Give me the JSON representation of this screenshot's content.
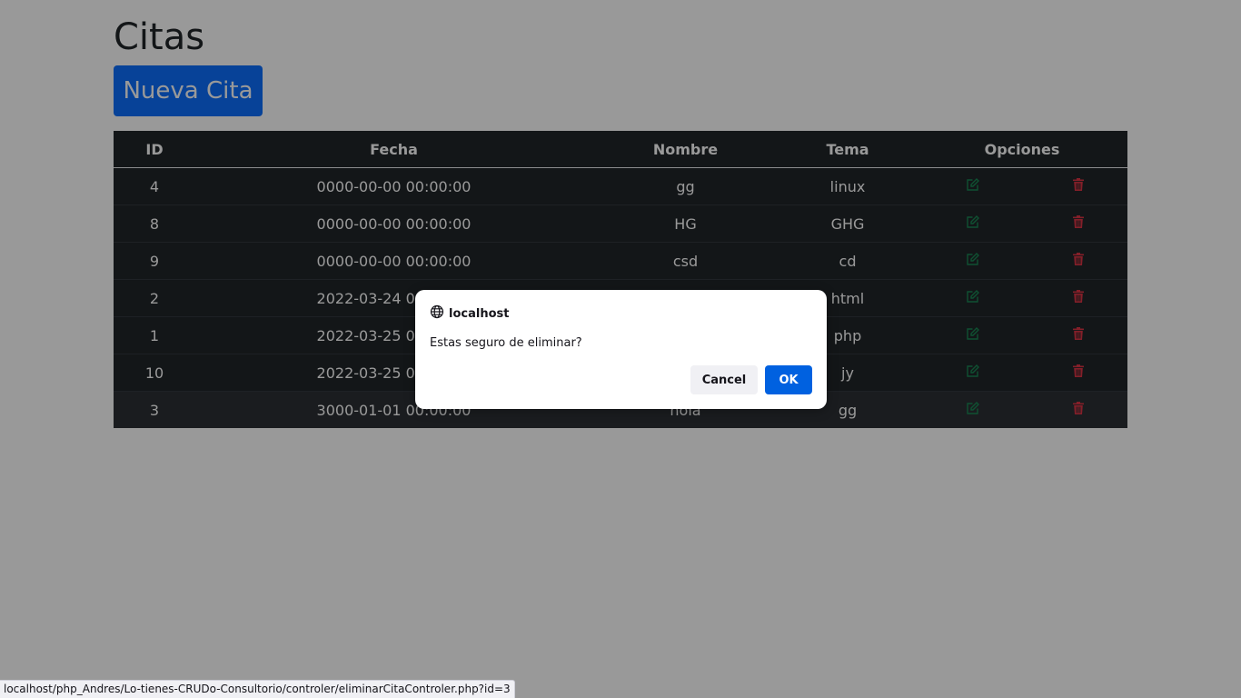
{
  "page": {
    "title": "Citas",
    "new_button_label": "Nueva Cita"
  },
  "table": {
    "headers": {
      "id": "ID",
      "fecha": "Fecha",
      "nombre": "Nombre",
      "tema": "Tema",
      "opciones": "Opciones"
    },
    "rows": [
      {
        "id": "4",
        "fecha": "0000-00-00 00:00:00",
        "nombre": "gg",
        "tema": "linux"
      },
      {
        "id": "8",
        "fecha": "0000-00-00 00:00:00",
        "nombre": "HG",
        "tema": "GHG"
      },
      {
        "id": "9",
        "fecha": "0000-00-00 00:00:00",
        "nombre": "csd",
        "tema": "cd"
      },
      {
        "id": "2",
        "fecha": "2022-03-24 00:00:00",
        "nombre": "",
        "tema": "html"
      },
      {
        "id": "1",
        "fecha": "2022-03-25 00:00:00",
        "nombre": "",
        "tema": "php"
      },
      {
        "id": "10",
        "fecha": "2022-03-25 00:00:00",
        "nombre": "",
        "tema": "jy"
      },
      {
        "id": "3",
        "fecha": "3000-01-01 00:00:00",
        "nombre": "hola",
        "tema": "gg"
      }
    ],
    "edit_icon": "edit-icon",
    "delete_icon": "trash-icon",
    "edit_color": "#198754",
    "delete_color": "#dc3545"
  },
  "dialog": {
    "origin": "localhost",
    "message": "Estas seguro de eliminar?",
    "cancel_label": "Cancel",
    "ok_label": "OK"
  },
  "status_bar": {
    "url": "localhost/php_Andres/Lo-tienes-CRUDo-Consultorio/controler/eliminarCitaControler.php?id=3"
  },
  "colors": {
    "primary": "#0d6efd",
    "table_dark": "#212529",
    "dialog_ok": "#0061e0"
  }
}
